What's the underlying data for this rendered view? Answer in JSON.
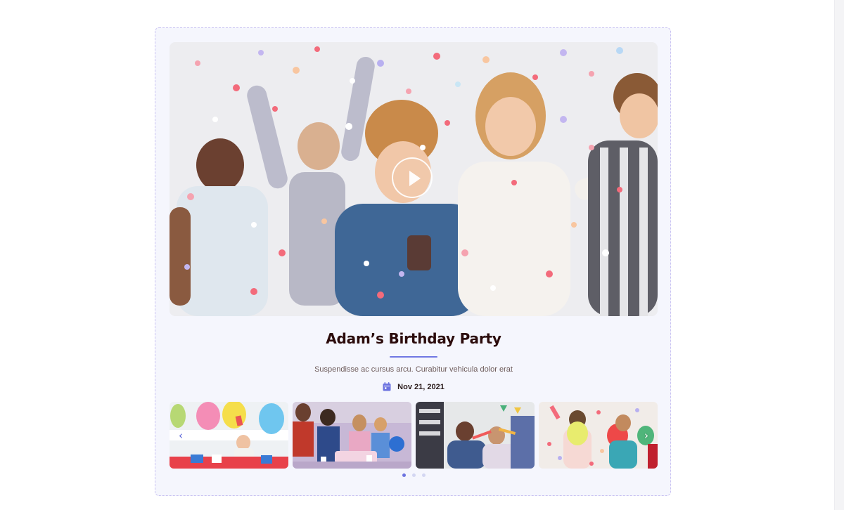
{
  "event": {
    "title": "Adam’s Birthday Party",
    "description": "Suspendisse ac cursus arcu. Curabitur vehicula dolor erat",
    "date": "Nov 21, 2021"
  },
  "icons": {
    "play": "play-icon",
    "calendar": "calendar-icon",
    "prev": "chevron-left-icon",
    "next": "chevron-right-icon"
  },
  "colors": {
    "accent": "#6c73e0",
    "title": "#2b0b0b",
    "card_background": "#f5f6fd",
    "card_border": "#c9c2f2"
  },
  "thumbnails": {
    "count": 4
  },
  "carousel": {
    "dots": 3,
    "active_index": 0
  },
  "arrows": {
    "prev": "‹",
    "next": "›"
  }
}
